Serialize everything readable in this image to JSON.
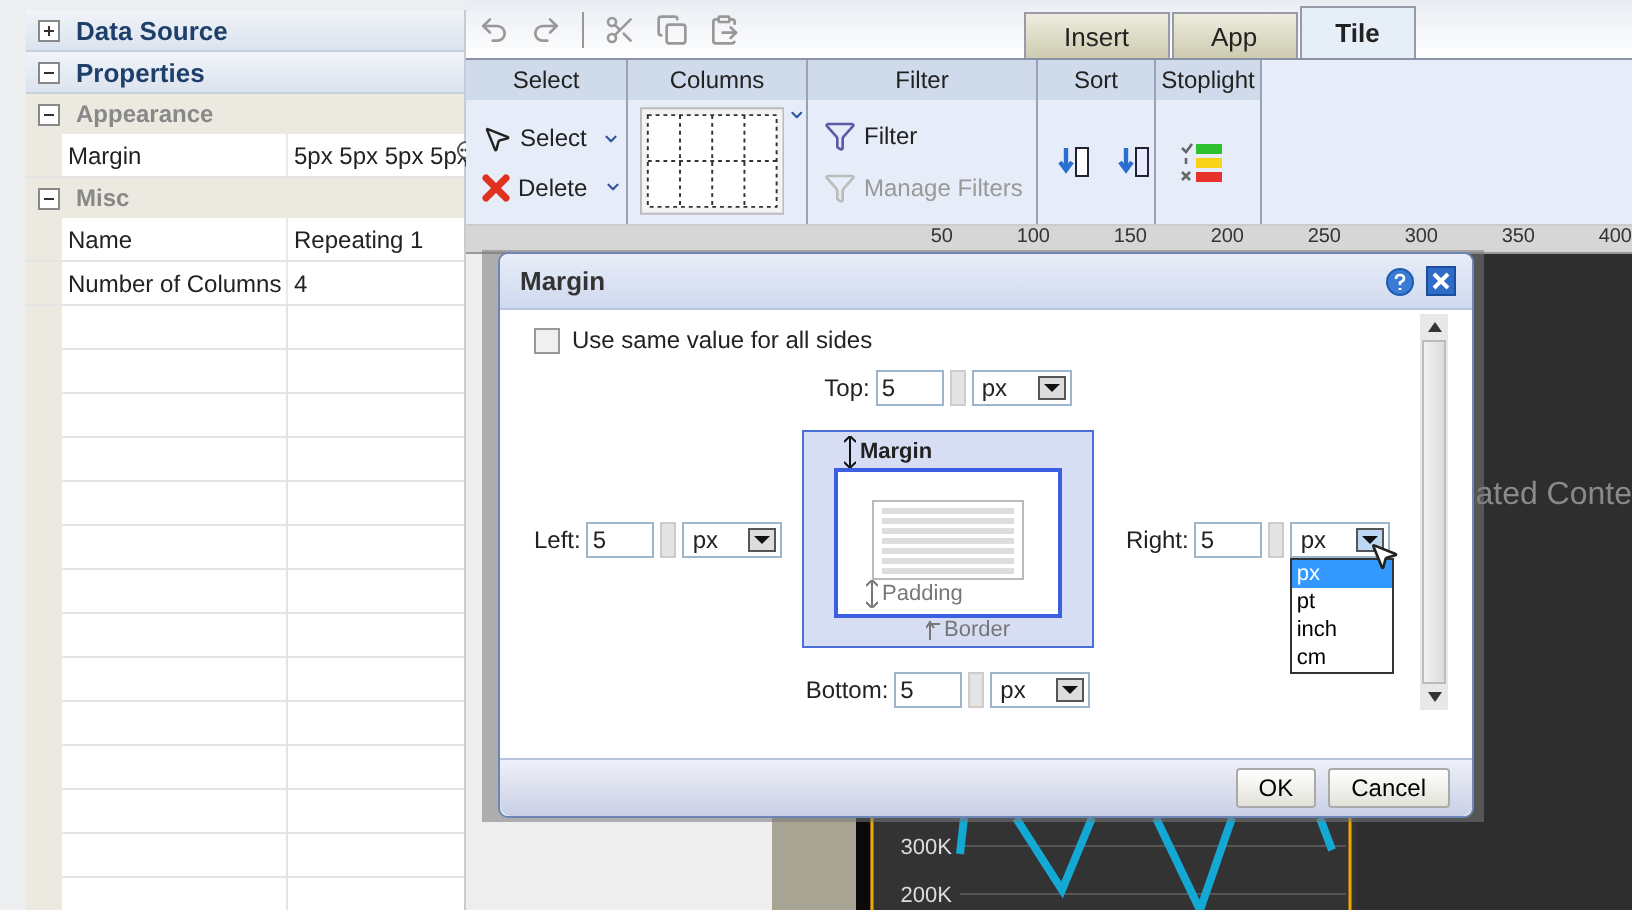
{
  "left_panel": {
    "sections": [
      {
        "title": "Data Source",
        "expanded": false
      },
      {
        "title": "Properties",
        "expanded": true
      }
    ],
    "groups": [
      {
        "title": "Appearance",
        "expanded": true,
        "rows": [
          {
            "name": "Margin",
            "value": "5px 5px 5px 5px",
            "kind": "editor"
          }
        ]
      },
      {
        "title": "Misc",
        "expanded": true,
        "rows": [
          {
            "name": "Name",
            "value": "Repeating 1",
            "kind": "plain"
          },
          {
            "name": "Number of Columns",
            "value": "4",
            "kind": "plain"
          }
        ]
      }
    ]
  },
  "tabs": [
    {
      "label": "Insert",
      "selected": false
    },
    {
      "label": "App",
      "selected": false
    },
    {
      "label": "Tile",
      "selected": true
    }
  ],
  "ribbon": [
    {
      "title": "Select",
      "kind": "buttons",
      "items": [
        {
          "label": "Select",
          "disabled": false,
          "dropdown": true
        },
        {
          "label": "Delete",
          "disabled": false,
          "dropdown": true
        }
      ]
    },
    {
      "title": "Columns",
      "kind": "columns"
    },
    {
      "title": "Filter",
      "kind": "buttons",
      "items": [
        {
          "label": "Filter",
          "disabled": false,
          "dropdown": false
        },
        {
          "label": "Manage Filters",
          "disabled": true,
          "dropdown": false
        }
      ]
    },
    {
      "title": "Sort",
      "kind": "sort"
    },
    {
      "title": "Stoplight",
      "kind": "stoplight"
    }
  ],
  "ruler": {
    "ticks": [
      "50",
      "100",
      "150",
      "200",
      "250",
      "300",
      "350",
      "400"
    ]
  },
  "canvas": {
    "heading": "ated Conte",
    "chart": {
      "tick_labels": [
        "300K",
        "200K"
      ]
    }
  },
  "dialog": {
    "title": "Margin",
    "same_value": {
      "label": "Use same value for all sides",
      "checked": false
    },
    "sides": [
      {
        "kind": "top",
        "label": "Top:",
        "value": "5",
        "unit": "px",
        "open": false
      },
      {
        "kind": "left",
        "label": "Left:",
        "value": "5",
        "unit": "px",
        "open": false
      },
      {
        "kind": "right",
        "label": "Right:",
        "value": "5",
        "unit": "px",
        "open": true,
        "options": [
          {
            "label": "px",
            "selected": true
          },
          {
            "label": "pt",
            "selected": false
          },
          {
            "label": "inch",
            "selected": false
          },
          {
            "label": "cm",
            "selected": false
          }
        ]
      },
      {
        "kind": "bottom",
        "label": "Bottom:",
        "value": "5",
        "unit": "px",
        "open": false
      }
    ],
    "diagram": {
      "margin": "Margin",
      "padding": "Padding",
      "border": "Border"
    },
    "buttons": [
      "OK",
      "Cancel"
    ]
  }
}
